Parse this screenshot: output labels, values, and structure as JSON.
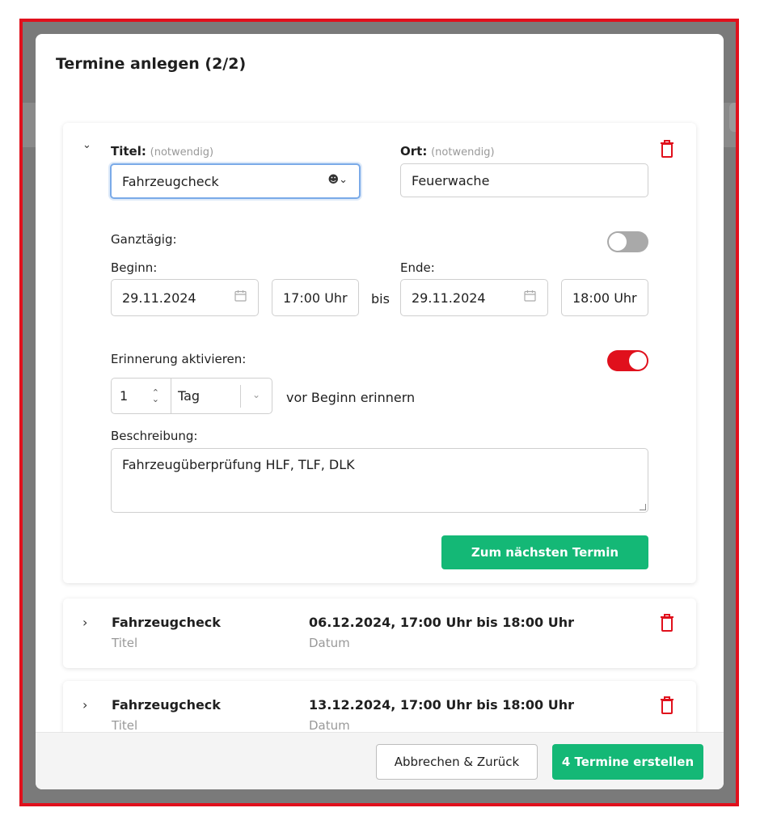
{
  "modal": {
    "title": "Termine anlegen (2/2)"
  },
  "form": {
    "title_label": "Titel:",
    "title_hint": "(notwendig)",
    "title_value": "Fahrzeugcheck",
    "location_label": "Ort:",
    "location_hint": "(notwendig)",
    "location_value": "Feuerwache",
    "allday_label": "Ganztägig:",
    "allday_on": false,
    "start_label": "Beginn:",
    "start_date": "29.11.2024",
    "start_time": "17:00 Uhr",
    "until_label": "bis",
    "end_label": "Ende:",
    "end_date": "29.11.2024",
    "end_time": "18:00 Uhr",
    "reminder_label": "Erinnerung aktivieren:",
    "reminder_on": true,
    "reminder_amount": "1",
    "reminder_unit": "Tag",
    "reminder_suffix": "vor Beginn erinnern",
    "description_label": "Beschreibung:",
    "description_value": "Fahrzeugüberprüfung HLF, TLF, DLK",
    "next_button": "Zum nächsten Termin"
  },
  "appointments": [
    {
      "title": "Fahrzeugcheck",
      "title_caption": "Titel",
      "date": "06.12.2024, 17:00 Uhr bis 18:00 Uhr",
      "date_caption": "Datum"
    },
    {
      "title": "Fahrzeugcheck",
      "title_caption": "Titel",
      "date": "13.12.2024, 17:00 Uhr bis 18:00 Uhr",
      "date_caption": "Datum"
    }
  ],
  "footer": {
    "cancel_button": "Abbrechen & Zurück",
    "create_button": "4 Termine erstellen"
  },
  "colors": {
    "accent_green": "#14b876",
    "danger_red": "#e0101c",
    "focus_blue": "#7aaae8"
  },
  "icons": {
    "collapse": "chevron-down-icon",
    "expand": "chevron-right-icon",
    "delete": "trash-icon",
    "calendar": "calendar-icon",
    "person_picker": "person-dropdown-icon",
    "stepper": "stepper-icon",
    "select": "chevron-down-icon"
  }
}
